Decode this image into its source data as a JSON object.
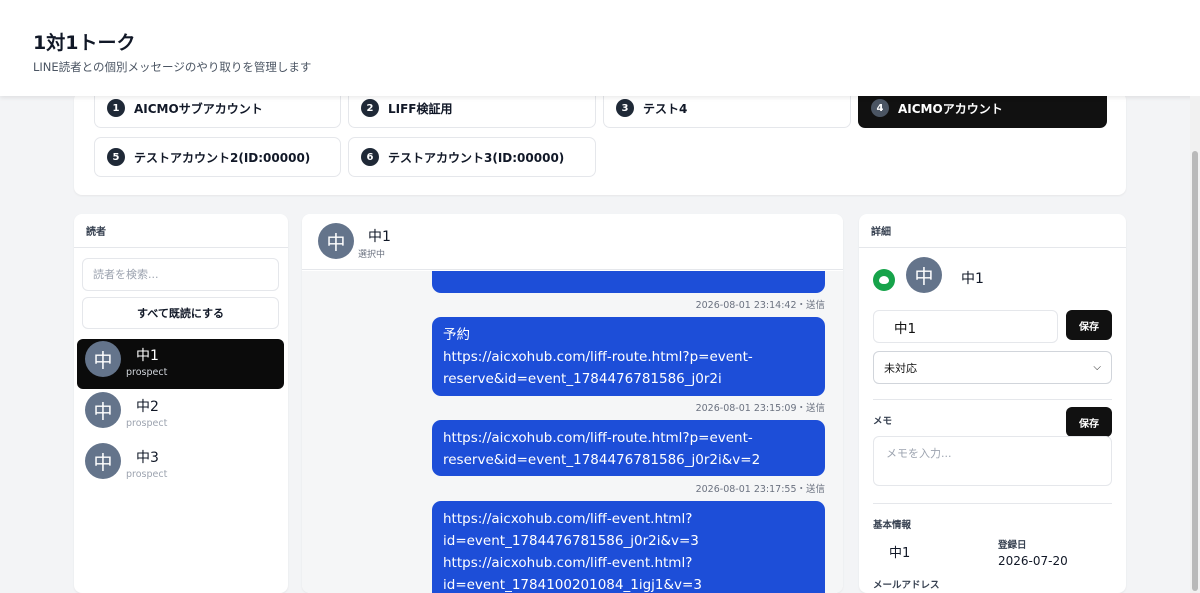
{
  "header": {
    "title": "1対1トーク",
    "subtitle": "LINE読者との個別メッセージのやり取りを管理します"
  },
  "accounts": [
    {
      "num": "1",
      "label": "AICMOサブアカウント",
      "active": false
    },
    {
      "num": "2",
      "label": "LIFF検証用",
      "active": false
    },
    {
      "num": "3",
      "label": "テスト4",
      "active": false
    },
    {
      "num": "4",
      "label": "AICMOアカウント",
      "active": true
    },
    {
      "num": "5",
      "label": "テストアカウント2(ID:00000)",
      "active": false
    },
    {
      "num": "6",
      "label": "テストアカウント3(ID:00000)",
      "active": false
    }
  ],
  "readers": {
    "title": "読者",
    "search_placeholder": "読者を検索...",
    "mark_all_read_label": "すべて既読にする",
    "list": [
      {
        "avatar": "中",
        "name": "中1",
        "status": "prospect",
        "selected": true
      },
      {
        "avatar": "中",
        "name": "中2",
        "status": "prospect",
        "selected": false
      },
      {
        "avatar": "中",
        "name": "中3",
        "status": "prospect",
        "selected": false
      }
    ]
  },
  "chat": {
    "avatar": "中",
    "name": "中1",
    "subtitle": "選択中",
    "messages": [
      {
        "text": "",
        "time": "2026-08-01 23:14:42・送信"
      },
      {
        "text": "予約\nhttps://aicxohub.com/liff-route.html?p=event-reserve&id=event_1784476781586_j0r2i",
        "time": "2026-08-01 23:15:09・送信"
      },
      {
        "text": "https://aicxohub.com/liff-route.html?p=event-reserve&id=event_1784476781586_j0r2i&v=2",
        "time": "2026-08-01 23:17:55・送信"
      },
      {
        "text": "https://aicxohub.com/liff-event.html?id=event_1784476781586_j0r2i&v=3\nhttps://aicxohub.com/liff-event.html?id=event_1784100201084_1igj1&v=3",
        "time": ""
      }
    ]
  },
  "detail": {
    "title": "詳細",
    "avatar": "中",
    "name": "中1",
    "name_input_value": "中1",
    "save_label": "保存",
    "status_value": "未対応",
    "memo_label": "メモ",
    "memo_placeholder": "メモを入力...",
    "basic_info_label": "基本情報",
    "basic_name_value": "中1",
    "registered_label": "登録日",
    "registered_value": "2026-07-20",
    "email_label": "メールアドレス"
  },
  "colors": {
    "accent_dark": "#111111",
    "bubble_blue": "#1d4ed8",
    "line_green": "#16a34a",
    "avatar_gray": "#64748b"
  }
}
